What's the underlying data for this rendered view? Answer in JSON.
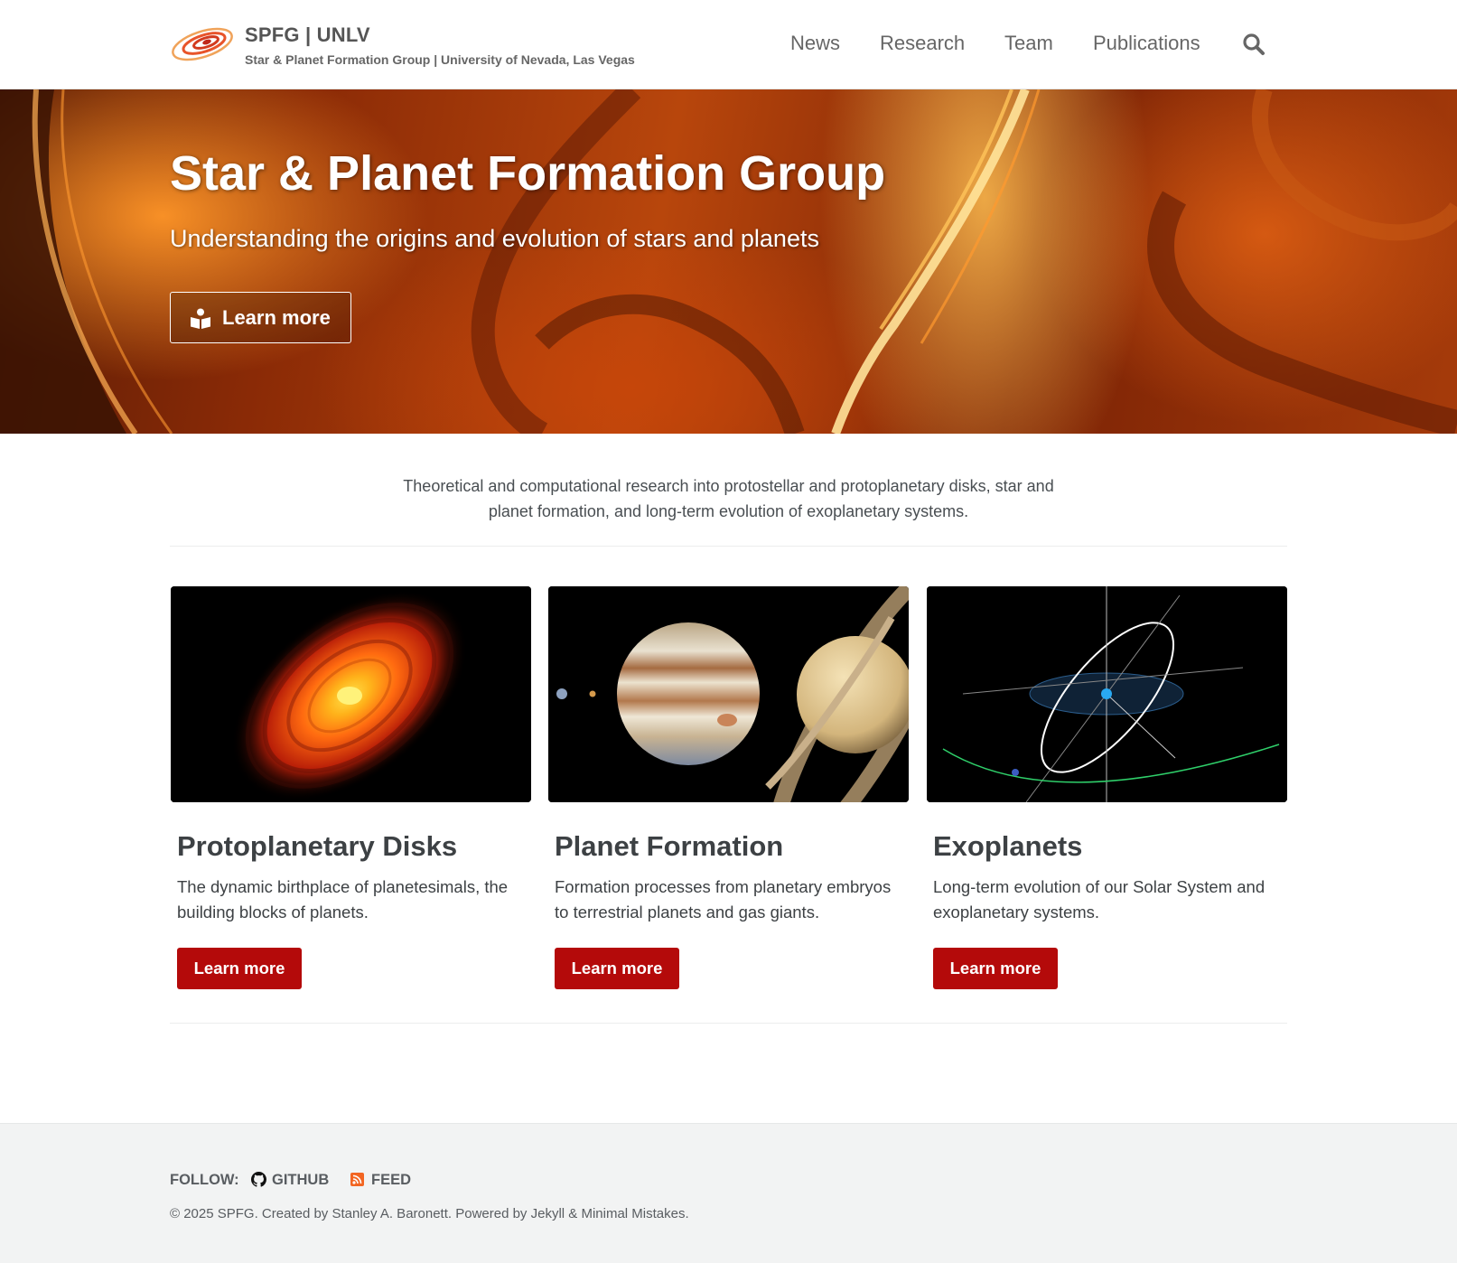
{
  "header": {
    "site_title": "SPFG | UNLV",
    "site_subtitle": "Star & Planet Formation Group | University of Nevada, Las Vegas",
    "nav": [
      "News",
      "Research",
      "Team",
      "Publications"
    ],
    "search_icon": "search-icon",
    "logo_icon": "galaxy-logo"
  },
  "hero": {
    "title": "Star & Planet Formation Group",
    "tagline": "Understanding the origins and evolution of stars and planets",
    "button_label": "Learn more",
    "button_icon": "book-reader-icon"
  },
  "intro": {
    "text": "Theoretical and computational research into protostellar and protoplanetary disks, star and planet formation, and long-term evolution of exoplanetary systems."
  },
  "features": [
    {
      "title": "Protoplanetary Disks",
      "text": "The dynamic birthplace of planetesimals, the building blocks of planets.",
      "button_label": "Learn more",
      "image": "protoplanetary-disk-image"
    },
    {
      "title": "Planet Formation",
      "text": "Formation processes from planetary embryos to terrestrial planets and gas giants.",
      "button_label": "Learn more",
      "image": "solar-system-planets-image"
    },
    {
      "title": "Exoplanets",
      "text": "Long-term evolution of our Solar System and exoplanetary systems.",
      "button_label": "Learn more",
      "image": "orbital-diagram-image"
    }
  ],
  "footer": {
    "follow_label": "FOLLOW:",
    "github_label": "GITHUB",
    "feed_label": "FEED",
    "copyright": "© 2025 SPFG. Created by Stanley A. Baronett. Powered by Jekyll & Minimal Mistakes."
  },
  "colors": {
    "accent_button": "#b40a0a",
    "hero_base": "#8a2a06",
    "footer_bg": "#f2f3f3",
    "feed_icon": "#f26522"
  }
}
